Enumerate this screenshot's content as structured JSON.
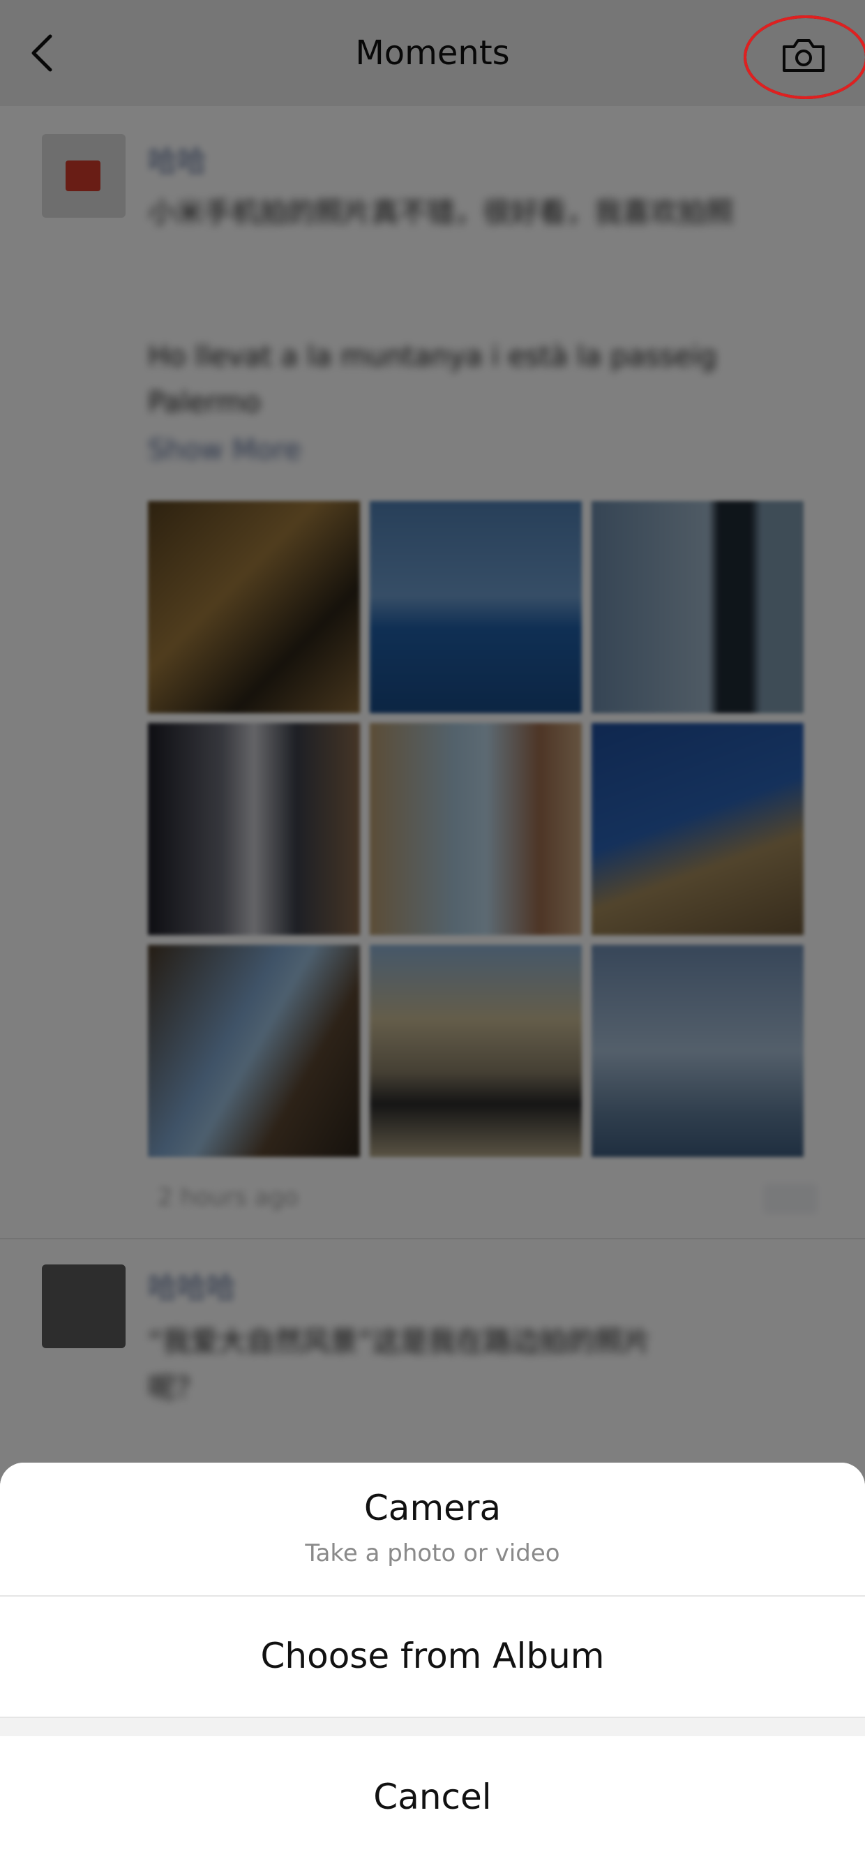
{
  "header": {
    "title": "Moments",
    "back_icon": "chevron-left-icon",
    "camera_icon": "camera-icon",
    "highlight_color": "#e02020"
  },
  "feed": {
    "posts": [
      {
        "author": "哈哈",
        "text_line_1": "小米手机拍的照片真不错，很好看，我喜欢拍照",
        "text_line_2": "Ho llevat a la muntanya i està la passeig",
        "text_line_3": "Palermo",
        "show_more": "Show More",
        "time": "2 hours ago"
      },
      {
        "author": "哈哈哈",
        "text_line_1": "“我爱大自然风景”这是我在路边拍的照片",
        "text_line_2": "呢？"
      }
    ]
  },
  "action_sheet": {
    "camera": {
      "label": "Camera",
      "subtitle": "Take a photo or video"
    },
    "album": {
      "label": "Choose from Album"
    },
    "cancel": {
      "label": "Cancel"
    }
  }
}
